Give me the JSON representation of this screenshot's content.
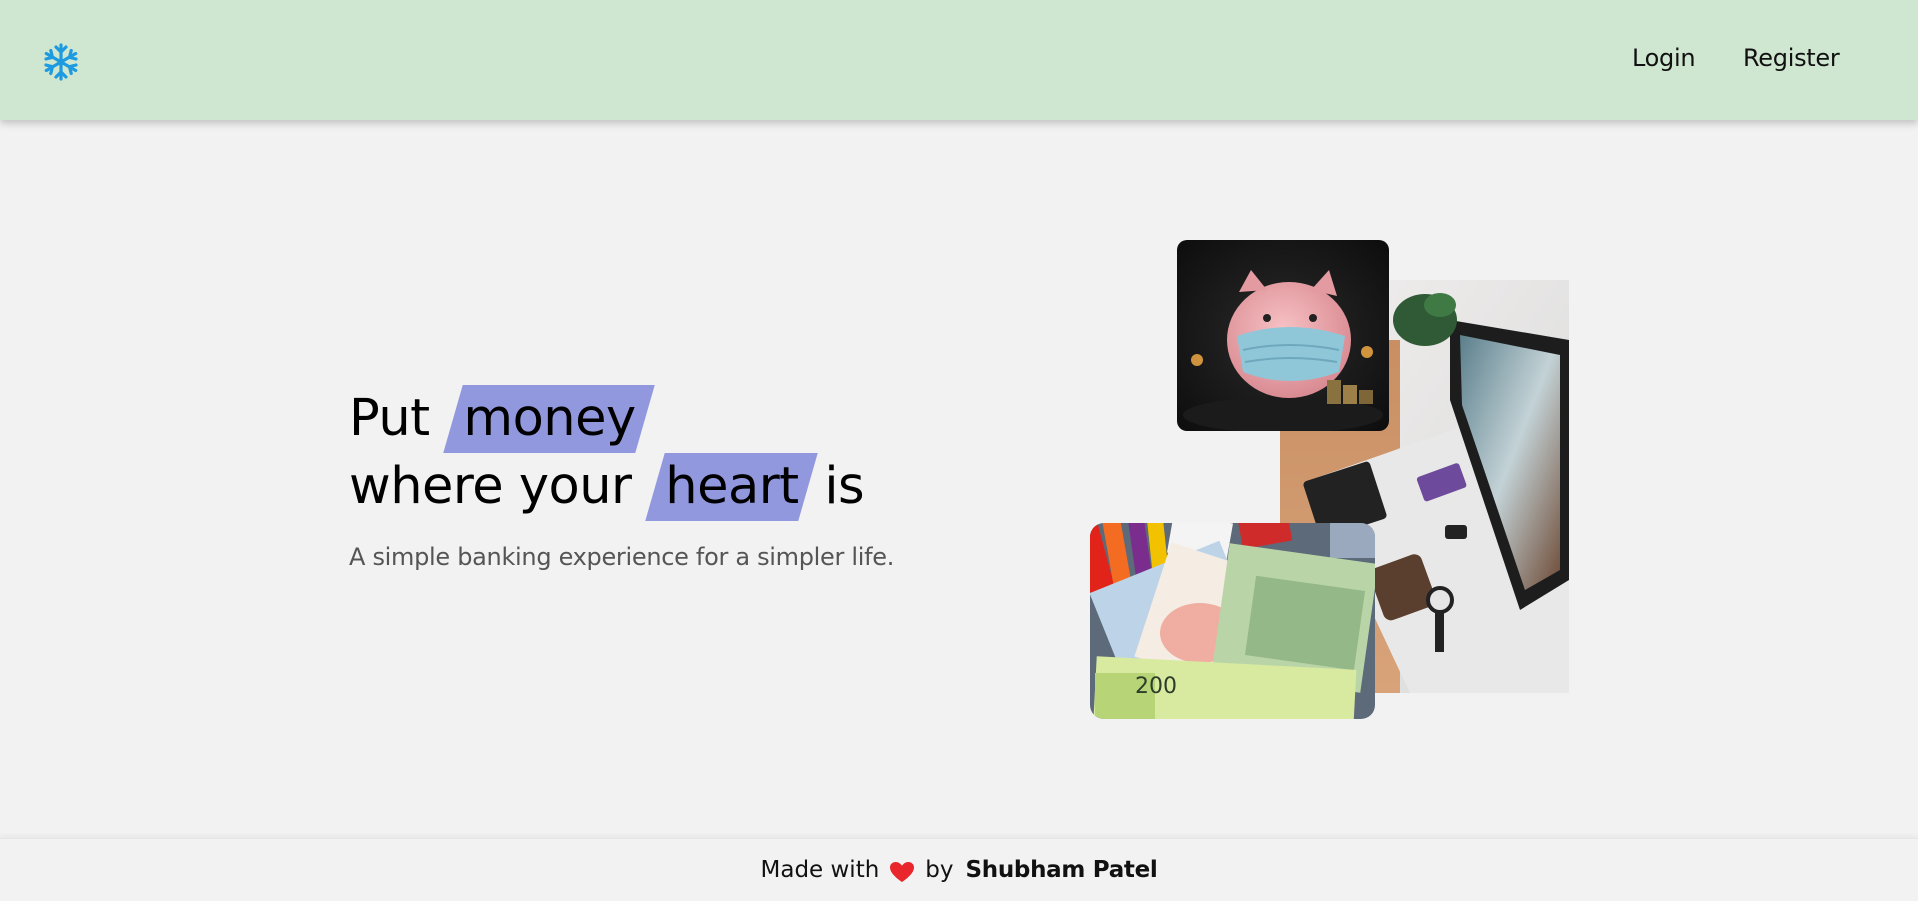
{
  "nav": {
    "logo_icon": "snowflake-icon",
    "login_label": "Login",
    "register_label": "Register",
    "background": "#cfe7d0"
  },
  "hero": {
    "line1_prefix": "Put",
    "line1_highlight": "money",
    "line2_prefix": "where your",
    "line2_highlight": "heart",
    "line2_suffix": "is",
    "subtitle": "A simple banking experience for a simpler life.",
    "highlight_color": "#9198dd"
  },
  "images": {
    "piggy_alt": "piggy-bank-with-mask",
    "desk_alt": "desk-with-laptop-and-cards",
    "cash_alt": "banknotes-and-markers"
  },
  "footer": {
    "made_with": "Made with",
    "heart_icon": "heart-icon",
    "by": "by",
    "author": "Shubham Patel"
  }
}
